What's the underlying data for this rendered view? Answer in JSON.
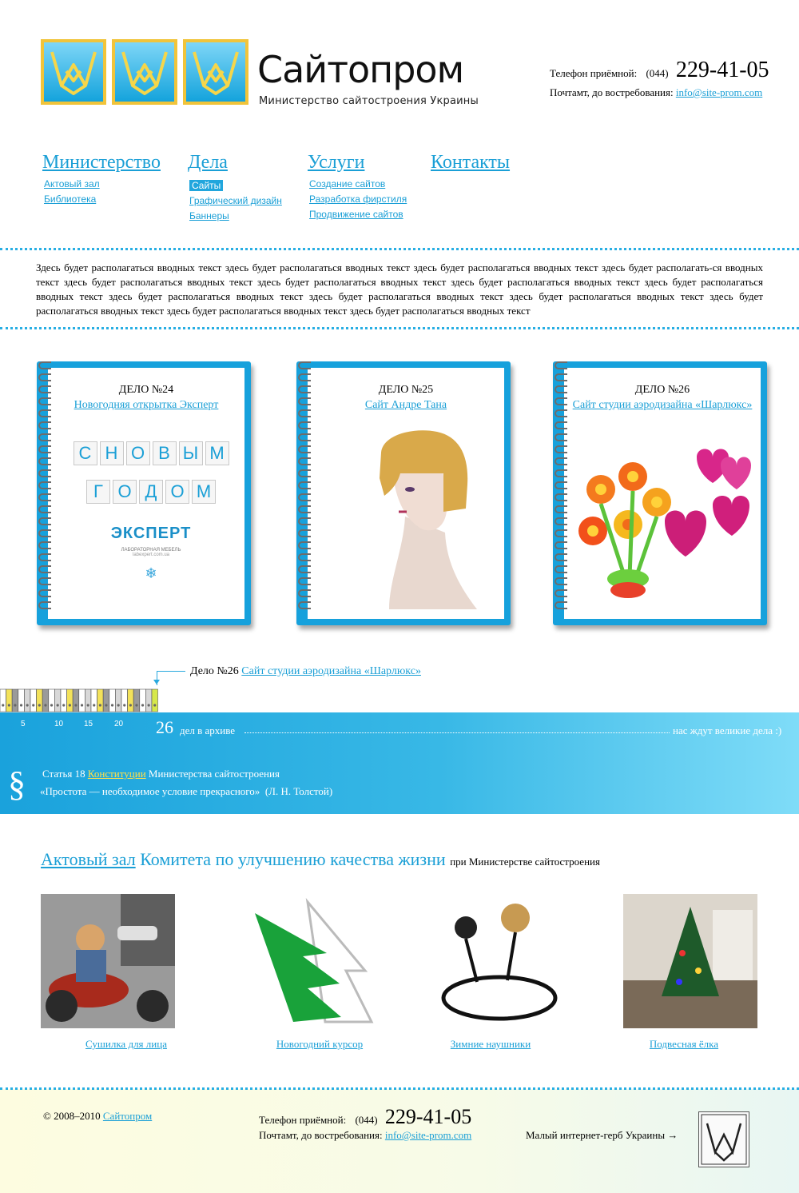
{
  "header": {
    "logo_title": "Сайтопром",
    "logo_subtitle": "Министерство сайтостроения Украины",
    "phone_label": "Телефон приёмной:",
    "phone_code": "(044)",
    "phone_number": "229-41-05",
    "mail_label": "Почтамт, до востребования:",
    "mail": "info@site-prom.com"
  },
  "nav": {
    "ministry": {
      "title": "Министерство",
      "items": [
        "Актовый зал",
        "Библиотека"
      ]
    },
    "cases": {
      "title": "Дела",
      "items": [
        "Сайты",
        "Графический дизайн",
        "Баннеры"
      ],
      "active": "Сайты"
    },
    "services": {
      "title": "Услуги",
      "items": [
        "Создание сайтов",
        "Разработка фирстиля",
        "Продвижение сайтов"
      ]
    },
    "contacts": {
      "title": "Контакты"
    }
  },
  "intro_text": "Здесь будет располагаться вводных текст здесь будет располагаться вводных текст здесь будет располагаться вводных текст здесь будет располагать-ся вводных текст здесь будет располагаться вводных текст здесь будет располагаться вводных текст здесь будет располагаться вводных текст здесь будет располагаться вводных текст здесь будет располагаться вводных текст здесь будет располагаться вводных текст здесь будет располагаться вводных текст здесь будет располагаться вводных текст здесь будет располагаться вводных текст здесь будет располагаться вводных текст",
  "cases": [
    {
      "number": "ДЕЛО №24",
      "title": "Новогодняя открытка Эксперт"
    },
    {
      "number": "ДЕЛО №25",
      "title": "Сайт Андре Тана"
    },
    {
      "number": "ДЕЛО №26",
      "title": "Сайт студии аэродизайна «Шарлюкс»"
    }
  ],
  "card24": {
    "tiles_row1": [
      "С",
      "Н",
      "О",
      "В",
      "Ы",
      "М"
    ],
    "tiles_row2": [
      "Г",
      "О",
      "Д",
      "О",
      "М"
    ],
    "brand": "ЭКСПЕРТ",
    "brand_sub": "ЛАБОРАТОРНАЯ МЕБЕЛЬ",
    "brand_url": "labexpert.com.ua"
  },
  "archive": {
    "pointer_prefix": "Дело №26",
    "pointer_link": "Сайт студии аэродизайна «Шарлюкс»",
    "ticks": [
      "5",
      "10",
      "15",
      "20"
    ],
    "count": "26",
    "count_label": "дел в архиве",
    "tail": "нас ждут великие дела :)"
  },
  "constitution": {
    "sign": "§",
    "prefix": "Статья 18",
    "link": "Конституции",
    "suffix": "Министерства сайтостроения",
    "quote": "«Простота — необходимое условие прекрасного»",
    "author": "(Л. Н. Толстой)"
  },
  "hall": {
    "link": "Актовый зал",
    "title_rest": "Комитета по улучшению качества жизни",
    "suffix": "при Министерстве сайтостроения",
    "items": [
      "Сушилка для лица",
      "Новогодний курсор",
      "Зимние наушники",
      "Подвесная ёлка"
    ]
  },
  "footer": {
    "copyright": "© 2008–2010",
    "copyright_link": "Сайтопром",
    "gerb_label": "Малый интернет-герб Украины →"
  },
  "colors": {
    "accent": "#1a9fd6",
    "gold": "#f1c43a",
    "band": "#1aa2dc"
  },
  "icons": {
    "logo": "w-tile-icon",
    "pointer": "arrow-down-icon",
    "paragraph": "section-sign-icon",
    "coat_of_arms": "gerb-icon",
    "snowflake": "snowflake-icon"
  }
}
